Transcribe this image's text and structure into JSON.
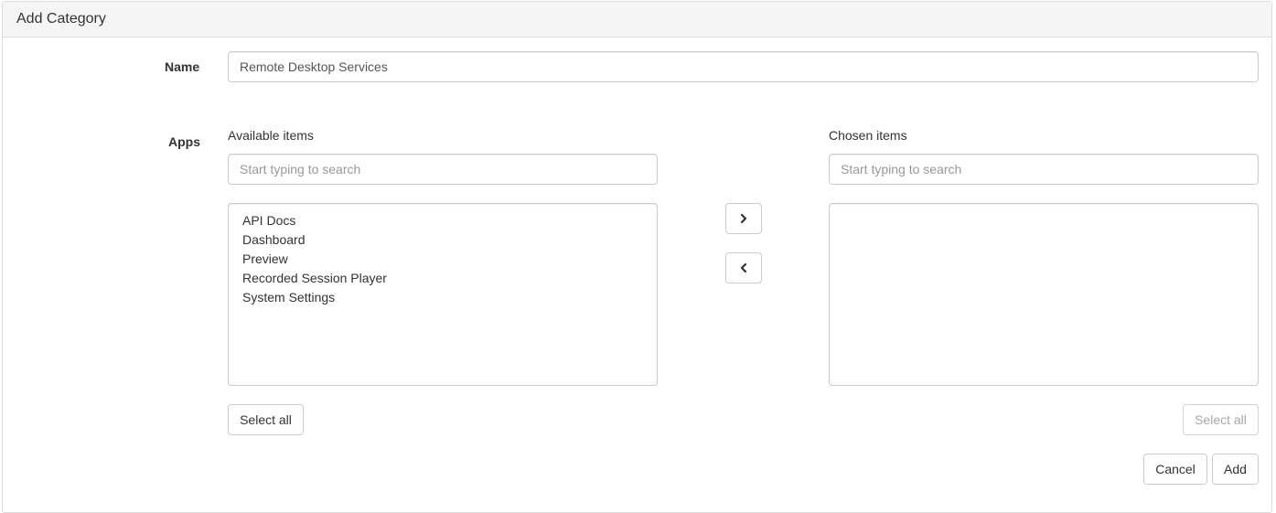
{
  "panel": {
    "title": "Add Category"
  },
  "form": {
    "name_label": "Name",
    "name_value": "Remote Desktop Services",
    "apps_label": "Apps"
  },
  "available": {
    "header": "Available items",
    "search_placeholder": "Start typing to search",
    "items": [
      "API Docs",
      "Dashboard",
      "Preview",
      "Recorded Session Player",
      "System Settings"
    ],
    "select_all_label": "Select all"
  },
  "chosen": {
    "header": "Chosen items",
    "search_placeholder": "Start typing to search",
    "items": [],
    "select_all_label": "Select all"
  },
  "transfer": {
    "move_right_icon": "chevron-right-icon",
    "move_left_icon": "chevron-left-icon"
  },
  "footer": {
    "cancel_label": "Cancel",
    "add_label": "Add"
  }
}
